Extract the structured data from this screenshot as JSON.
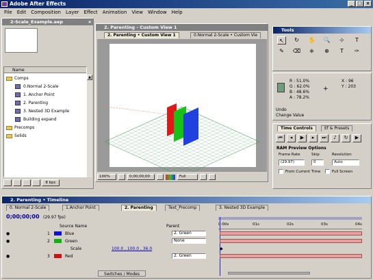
{
  "app": {
    "title": "Adobe After Effects"
  },
  "menu": [
    "File",
    "Edit",
    "Composition",
    "Layer",
    "Effect",
    "Animation",
    "View",
    "Window",
    "Help"
  ],
  "project": {
    "title": "2-Scale_Example.aep",
    "col_name": "Name",
    "items": [
      {
        "label": "Comps",
        "kind": "folder"
      },
      {
        "label": "0.Normal 2-Scale",
        "kind": "comp"
      },
      {
        "label": "1. Anchor Point",
        "kind": "comp"
      },
      {
        "label": "2. Parenting",
        "kind": "comp"
      },
      {
        "label": "3. Nested 3D Example",
        "kind": "comp"
      },
      {
        "label": "Building expand",
        "kind": "comp"
      },
      {
        "label": "Precomps",
        "kind": "folder"
      },
      {
        "label": "Solids",
        "kind": "folder"
      }
    ],
    "bpc": "8 bpc"
  },
  "comp_window": {
    "title": "2. Parenting - Custom View 1",
    "tabs": [
      "2. Parenting • Custom View 1",
      "0.Normal 2-Scale • Custom Vie"
    ],
    "zoom": "100%",
    "timecode": "0;00;00;00",
    "resolution": "Full"
  },
  "tools": {
    "title": "Tools",
    "glyphs": [
      "↖",
      "↻",
      "✋",
      "🔍",
      "⊹",
      "T",
      "✎",
      "⌫",
      "⎈",
      "⊕",
      "T",
      "✑"
    ]
  },
  "info": {
    "r": "R : 51.0%",
    "g": "G : 62.0%",
    "b": "B : 48.6%",
    "a": "A : 78.2%",
    "x": "X : 96",
    "y": "Y : 203",
    "undo_label": "Undo",
    "undo_value": "Change Value",
    "swatch_color": "#6f9e7c"
  },
  "time_controls": {
    "tabs": [
      "Time Controls",
      "Ef & Presets"
    ],
    "ram_title": "RAM Preview Options",
    "frame_rate_label": "Frame Rate",
    "skip_label": "Skip",
    "resolution_label": "Resolution",
    "frame_rate": "(29.97)",
    "skip": "0",
    "resolution": "Auto",
    "from_current": "From Current Time",
    "full_screen": "Full Screen"
  },
  "timeline": {
    "title": "2. Parenting • Timeline",
    "tabs": [
      "0. Normal 2-Scale",
      "1.Anchor Point",
      "2. Parenting",
      "Text_Precomp",
      "3. Nested 3D Example"
    ],
    "timecode": "0;00;00;00",
    "fps": "(29.97 fps)",
    "col_source": "Source Name",
    "col_parent": "Parent",
    "ruler": [
      "0:00s",
      "01s",
      "02s",
      "03s",
      "04s"
    ],
    "layers": [
      {
        "num": "1",
        "name": "Blue",
        "color": "#1010d0",
        "parent": "2. Green"
      },
      {
        "num": "2",
        "name": "Green",
        "color": "#10b010",
        "parent": "None"
      },
      {
        "num": "",
        "name": "Scale",
        "color": "",
        "parent": "",
        "value": "100.0 , 100.0 , 36.0"
      },
      {
        "num": "3",
        "name": "Red",
        "color": "#d01010",
        "parent": "2. Green"
      }
    ],
    "switches": "Switches / Modes"
  }
}
